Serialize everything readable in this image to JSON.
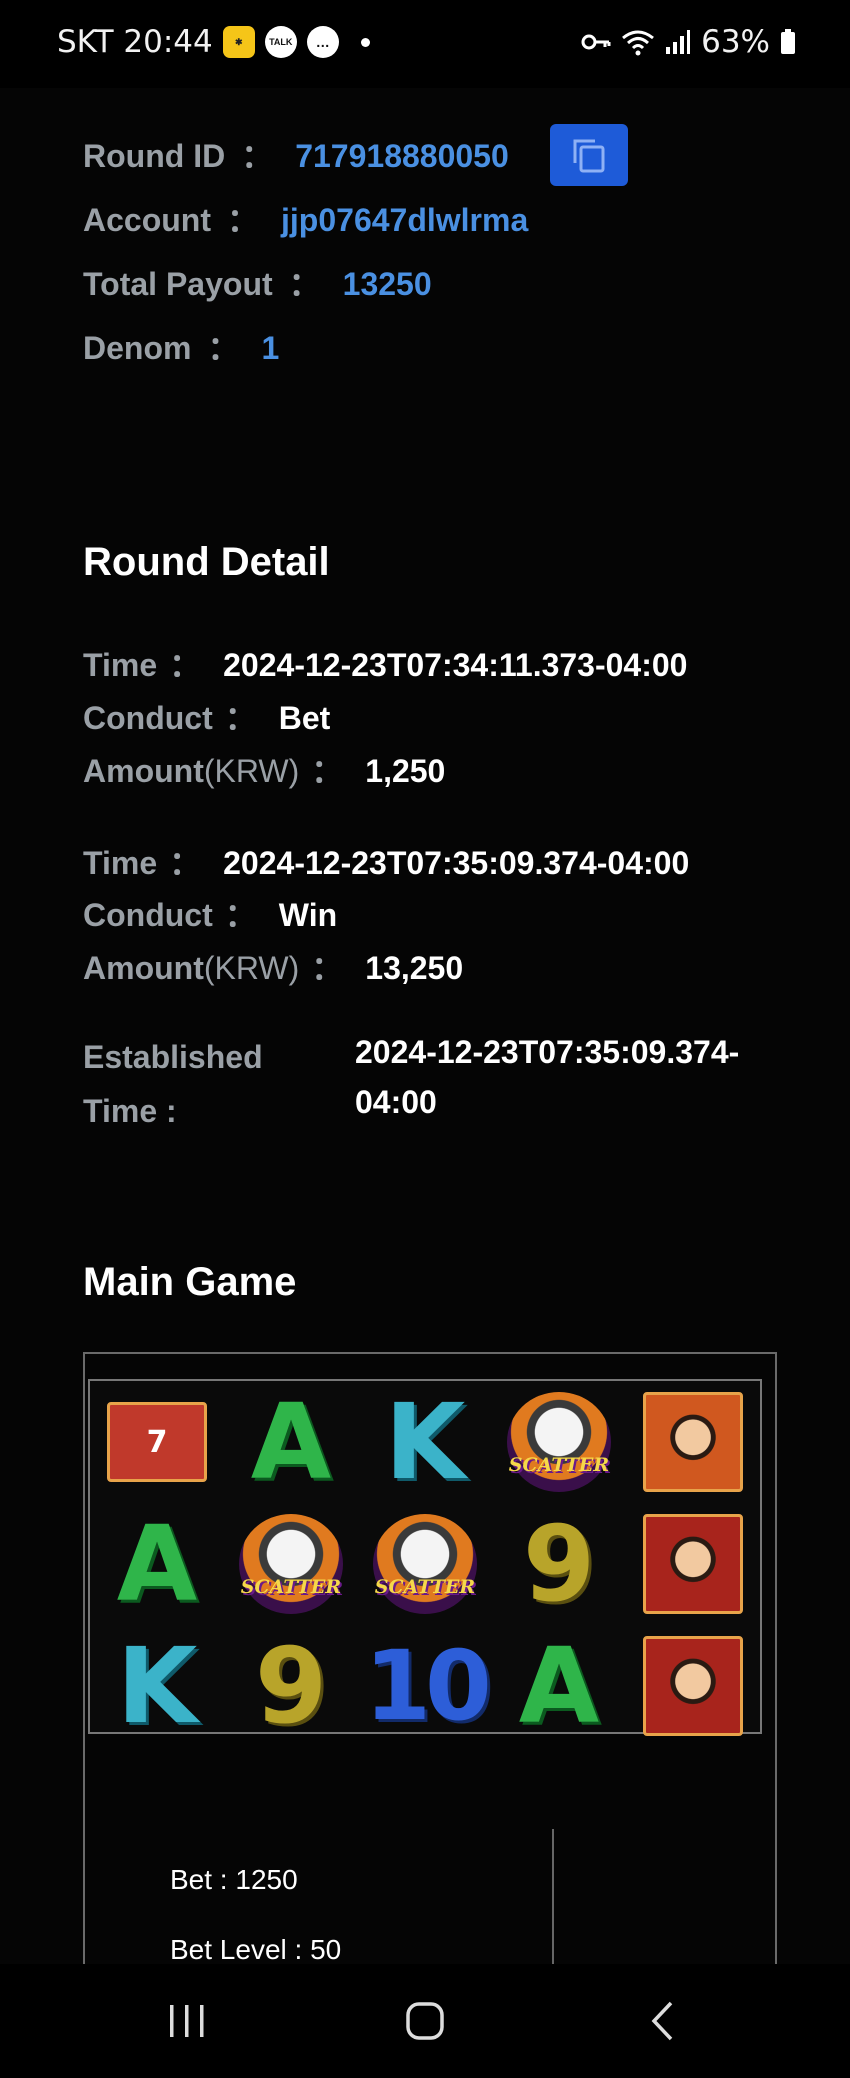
{
  "status_bar": {
    "carrier_time": "SKT 20:44",
    "app_icons": [
      "kakaopay-icon",
      "kakaotalk-icon",
      "chat-icon"
    ],
    "kakaotalk_label": "TALK",
    "battery": "63%"
  },
  "round_info": {
    "round_id_label": "Round ID",
    "round_id": "717918880050",
    "account_label": "Account",
    "account": "jjp07647dlwlrma",
    "total_payout_label": "Total Payout",
    "total_payout": "13250",
    "denom_label": "Denom",
    "denom": "1",
    "separator": "："
  },
  "round_detail": {
    "title": "Round Detail",
    "entries": [
      {
        "time_label": "Time",
        "time": "2024-12-23T07:34:11.373-04:00",
        "conduct_label": "Conduct",
        "conduct": "Bet",
        "amount_label": "Amount",
        "amount_unit": "(KRW)",
        "amount": "1,250"
      },
      {
        "time_label": "Time",
        "time": "2024-12-23T07:35:09.374-04:00",
        "conduct_label": "Conduct",
        "conduct": "Win",
        "amount_label": "Amount",
        "amount_unit": "(KRW)",
        "amount": "13,250"
      }
    ],
    "established_label_1": "Established",
    "established_label_2": "Time :",
    "established_value_1": "2024-12-23T07:35:09.374-",
    "established_value_2": "04:00"
  },
  "main_game": {
    "title": "Main Game",
    "scatter_text": "SCATTER",
    "grid": [
      [
        "jersey",
        "A",
        "K",
        "scatter",
        "player-orange"
      ],
      [
        "A",
        "scatter",
        "scatter",
        "9",
        "player-red"
      ],
      [
        "K",
        "9",
        "10",
        "A",
        "player-red"
      ]
    ],
    "bet": "Bet : 1250",
    "bet_level": "Bet Level : 50"
  },
  "colors": {
    "background": "#050505",
    "label": "#9aa0a6",
    "link_value": "#4a90e2",
    "copy_button": "#1e5bd8"
  }
}
